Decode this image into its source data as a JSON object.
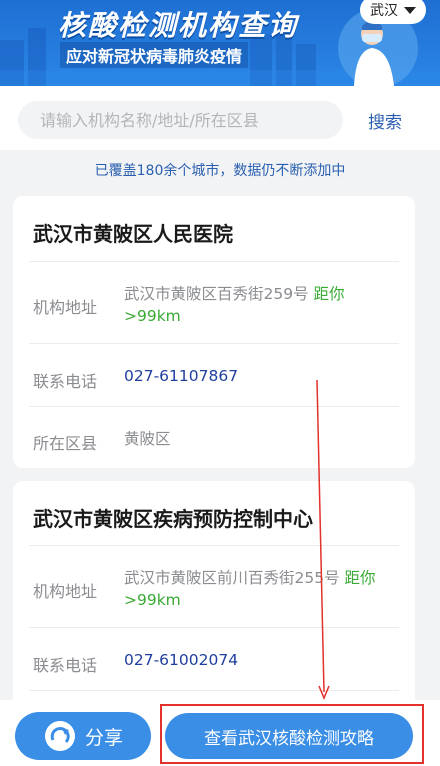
{
  "banner": {
    "title": "核酸检测机构查询",
    "subtitle": "应对新冠状病毒肺炎疫情",
    "city": "武汉"
  },
  "search": {
    "placeholder": "请输入机构名称/地址/所在区县",
    "button_label": "搜索"
  },
  "coverage_text": "已覆盖180余个城市，数据仍不断添加中",
  "cards": [
    {
      "name": "武汉市黄陂区人民医院",
      "address_label": "机构地址",
      "address": "武汉市黄陂区百秀街259号",
      "distance": "距你",
      "distance_value": ">99km",
      "phone_label": "联系电话",
      "phone": "027-61107867",
      "district_label": "所在区县",
      "district": "黄陂区"
    },
    {
      "name": "武汉市黄陂区疾病预防控制中心",
      "address_label": "机构地址",
      "address": "武汉市黄陂区前川百秀街255号",
      "distance": "距你",
      "distance_value": ">99km",
      "phone_label": "联系电话",
      "phone": "027-61002074"
    }
  ],
  "bottom": {
    "share_label": "分享",
    "guide_label": "查看武汉核酸检测攻略"
  },
  "colors": {
    "accent": "#3a8ee6",
    "link": "#2a5fb0",
    "distance": "#3aaa35",
    "phone": "#1f3f9e",
    "annotation": "#e3312c"
  },
  "icons": {
    "share": "share-icon",
    "dropdown": "caret-down-icon"
  }
}
